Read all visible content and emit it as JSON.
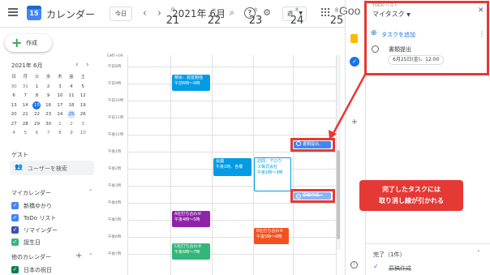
{
  "header": {
    "app_title": "カレンダー",
    "logo_date": "15",
    "today_label": "今日",
    "month_label": "2021年 6月",
    "view_label": "週",
    "google_logo": "Goo"
  },
  "sidebar": {
    "create_label": "作成",
    "mini_calendar": {
      "title": "2021年 6月",
      "weekdays": [
        "日",
        "月",
        "火",
        "水",
        "木",
        "金",
        "土"
      ],
      "weeks": [
        [
          "30",
          "31",
          "1",
          "2",
          "3",
          "4",
          "5"
        ],
        [
          "6",
          "7",
          "8",
          "9",
          "10",
          "11",
          "12"
        ],
        [
          "13",
          "14",
          "15",
          "16",
          "17",
          "18",
          "19"
        ],
        [
          "20",
          "21",
          "22",
          "23",
          "24",
          "25",
          "26"
        ],
        [
          "27",
          "28",
          "29",
          "30",
          "1",
          "2",
          "3"
        ],
        [
          "4",
          "5",
          "6",
          "7",
          "8",
          "9",
          "10"
        ]
      ]
    },
    "guest_title": "ゲスト",
    "guest_search": "ユーザーを検索",
    "my_calendars_title": "マイカレンダー",
    "my_calendars": [
      {
        "label": "新橋ゆかり",
        "color": "#4285f4"
      },
      {
        "label": "ToDo リスト",
        "color": "#4285f4"
      },
      {
        "label": "リマインダー",
        "color": "#3f51b5"
      },
      {
        "label": "誕生日",
        "color": "#33b679"
      }
    ],
    "other_calendars_title": "他のカレンダー",
    "other_calendars": [
      {
        "label": "日本の祝日",
        "color": "#0b8043"
      }
    ]
  },
  "grid": {
    "gmt_label": "GMT+09",
    "days": [
      {
        "dow": "月",
        "num": "21"
      },
      {
        "dow": "火",
        "num": "22"
      },
      {
        "dow": "水",
        "num": "23"
      },
      {
        "dow": "木",
        "num": "24"
      },
      {
        "dow": "金",
        "num": "25"
      }
    ],
    "hours": [
      "午前8時",
      "午前9時",
      "午前10時",
      "午前11時",
      "午後12時",
      "午後1時",
      "午後2時",
      "午後3時",
      "午後4時",
      "午後5時",
      "午後6時",
      "午後7時"
    ],
    "events": {
      "e1_title": "朝会：週並勉強",
      "e1_time": "午前6時〜9時",
      "e2_title": "会議",
      "e2_time": "午後1時、含橋",
      "e3_title": "訪問：アロウ",
      "e3_line2": "ス株式会社",
      "e3_time": "午後1時〜3時",
      "e4_title": "A社打ち合わせ",
      "e4_time": "午後4時〜5時",
      "e5_title": "B社打ち合わせ",
      "e5_time": "午後5時〜6時",
      "e6_title": "C社打ち合わせ",
      "e6_time": "午後6時〜7時"
    },
    "task_chip_1": "書類提出、",
    "task_chip_2": "原稿作成、"
  },
  "tasks_panel": {
    "caption": "TODO リスト",
    "list_name": "マイタスク",
    "add_task": "タスクを追加",
    "task_title": "書類提出",
    "task_due": "6月25日(金)、12:00",
    "completed_title": "完了（1件）",
    "completed_task": "原稿作成"
  },
  "callout": {
    "line1": "完了したタスクには",
    "line2": "取り消し線が引かれる"
  }
}
